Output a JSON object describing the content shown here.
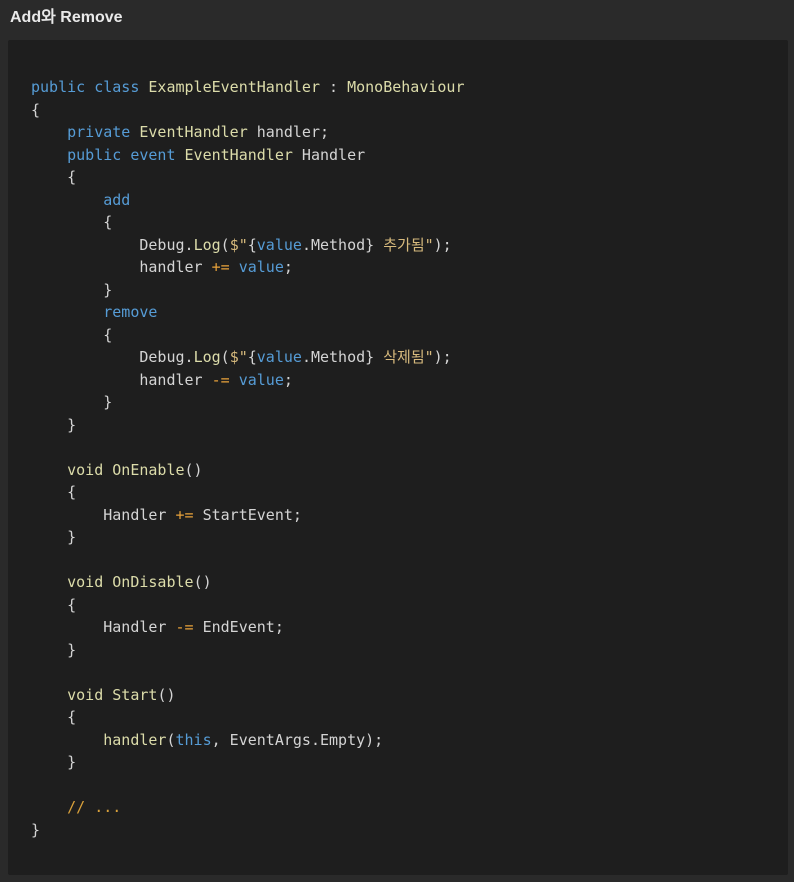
{
  "header": {
    "title": "Add와 Remove"
  },
  "code": {
    "lines": [
      [
        {
          "t": "public",
          "c": "kw"
        },
        {
          "t": " ",
          "c": "tx"
        },
        {
          "t": "class",
          "c": "kw"
        },
        {
          "t": " ",
          "c": "tx"
        },
        {
          "t": "ExampleEventHandler",
          "c": "ty"
        },
        {
          "t": " ",
          "c": "tx"
        },
        {
          "t": ":",
          "c": "tx"
        },
        {
          "t": " ",
          "c": "tx"
        },
        {
          "t": "MonoBehaviour",
          "c": "ty"
        }
      ],
      [
        {
          "t": "{",
          "c": "tx"
        }
      ],
      [
        {
          "t": "    ",
          "c": "tx"
        },
        {
          "t": "private",
          "c": "kw"
        },
        {
          "t": " ",
          "c": "tx"
        },
        {
          "t": "EventHandler",
          "c": "ty"
        },
        {
          "t": " handler;",
          "c": "tx"
        }
      ],
      [
        {
          "t": "    ",
          "c": "tx"
        },
        {
          "t": "public",
          "c": "kw"
        },
        {
          "t": " ",
          "c": "tx"
        },
        {
          "t": "event",
          "c": "kw"
        },
        {
          "t": " ",
          "c": "tx"
        },
        {
          "t": "EventHandler",
          "c": "ty"
        },
        {
          "t": " Handler",
          "c": "tx"
        }
      ],
      [
        {
          "t": "    {",
          "c": "tx"
        }
      ],
      [
        {
          "t": "        ",
          "c": "tx"
        },
        {
          "t": "add",
          "c": "kw"
        }
      ],
      [
        {
          "t": "        {",
          "c": "tx"
        }
      ],
      [
        {
          "t": "            Debug.",
          "c": "tx"
        },
        {
          "t": "Log",
          "c": "fn"
        },
        {
          "t": "(",
          "c": "tx"
        },
        {
          "t": "$\"",
          "c": "str"
        },
        {
          "t": "{",
          "c": "tx"
        },
        {
          "t": "value",
          "c": "kw"
        },
        {
          "t": ".Method}",
          "c": "tx"
        },
        {
          "t": " 추가됨\"",
          "c": "str"
        },
        {
          "t": ");",
          "c": "tx"
        }
      ],
      [
        {
          "t": "            handler ",
          "c": "tx"
        },
        {
          "t": "+=",
          "c": "op"
        },
        {
          "t": " ",
          "c": "tx"
        },
        {
          "t": "value",
          "c": "kw"
        },
        {
          "t": ";",
          "c": "tx"
        }
      ],
      [
        {
          "t": "        }",
          "c": "tx"
        }
      ],
      [
        {
          "t": "        ",
          "c": "tx"
        },
        {
          "t": "remove",
          "c": "kw"
        }
      ],
      [
        {
          "t": "        {",
          "c": "tx"
        }
      ],
      [
        {
          "t": "            Debug.",
          "c": "tx"
        },
        {
          "t": "Log",
          "c": "fn"
        },
        {
          "t": "(",
          "c": "tx"
        },
        {
          "t": "$\"",
          "c": "str"
        },
        {
          "t": "{",
          "c": "tx"
        },
        {
          "t": "value",
          "c": "kw"
        },
        {
          "t": ".Method}",
          "c": "tx"
        },
        {
          "t": " 삭제됨\"",
          "c": "str"
        },
        {
          "t": ");",
          "c": "tx"
        }
      ],
      [
        {
          "t": "            handler ",
          "c": "tx"
        },
        {
          "t": "-=",
          "c": "op"
        },
        {
          "t": " ",
          "c": "tx"
        },
        {
          "t": "value",
          "c": "kw"
        },
        {
          "t": ";",
          "c": "tx"
        }
      ],
      [
        {
          "t": "        }",
          "c": "tx"
        }
      ],
      [
        {
          "t": "    }",
          "c": "tx"
        }
      ],
      [],
      [
        {
          "t": "    ",
          "c": "tx"
        },
        {
          "t": "void",
          "c": "ty"
        },
        {
          "t": " ",
          "c": "tx"
        },
        {
          "t": "OnEnable",
          "c": "fn"
        },
        {
          "t": "()",
          "c": "tx"
        }
      ],
      [
        {
          "t": "    {",
          "c": "tx"
        }
      ],
      [
        {
          "t": "        Handler ",
          "c": "tx"
        },
        {
          "t": "+=",
          "c": "op"
        },
        {
          "t": " StartEvent;",
          "c": "tx"
        }
      ],
      [
        {
          "t": "    }",
          "c": "tx"
        }
      ],
      [],
      [
        {
          "t": "    ",
          "c": "tx"
        },
        {
          "t": "void",
          "c": "ty"
        },
        {
          "t": " ",
          "c": "tx"
        },
        {
          "t": "OnDisable",
          "c": "fn"
        },
        {
          "t": "()",
          "c": "tx"
        }
      ],
      [
        {
          "t": "    {",
          "c": "tx"
        }
      ],
      [
        {
          "t": "        Handler ",
          "c": "tx"
        },
        {
          "t": "-=",
          "c": "op"
        },
        {
          "t": " EndEvent;",
          "c": "tx"
        }
      ],
      [
        {
          "t": "    }",
          "c": "tx"
        }
      ],
      [],
      [
        {
          "t": "    ",
          "c": "tx"
        },
        {
          "t": "void",
          "c": "ty"
        },
        {
          "t": " ",
          "c": "tx"
        },
        {
          "t": "Start",
          "c": "fn"
        },
        {
          "t": "()",
          "c": "tx"
        }
      ],
      [
        {
          "t": "    {",
          "c": "tx"
        }
      ],
      [
        {
          "t": "        ",
          "c": "tx"
        },
        {
          "t": "handler",
          "c": "fn"
        },
        {
          "t": "(",
          "c": "tx"
        },
        {
          "t": "this",
          "c": "kw"
        },
        {
          "t": ", EventArgs.Empty);",
          "c": "tx"
        }
      ],
      [
        {
          "t": "    }",
          "c": "tx"
        }
      ],
      [],
      [
        {
          "t": "    ",
          "c": "tx"
        },
        {
          "t": "// ...",
          "c": "cm"
        }
      ],
      [
        {
          "t": "}",
          "c": "tx"
        }
      ]
    ]
  }
}
